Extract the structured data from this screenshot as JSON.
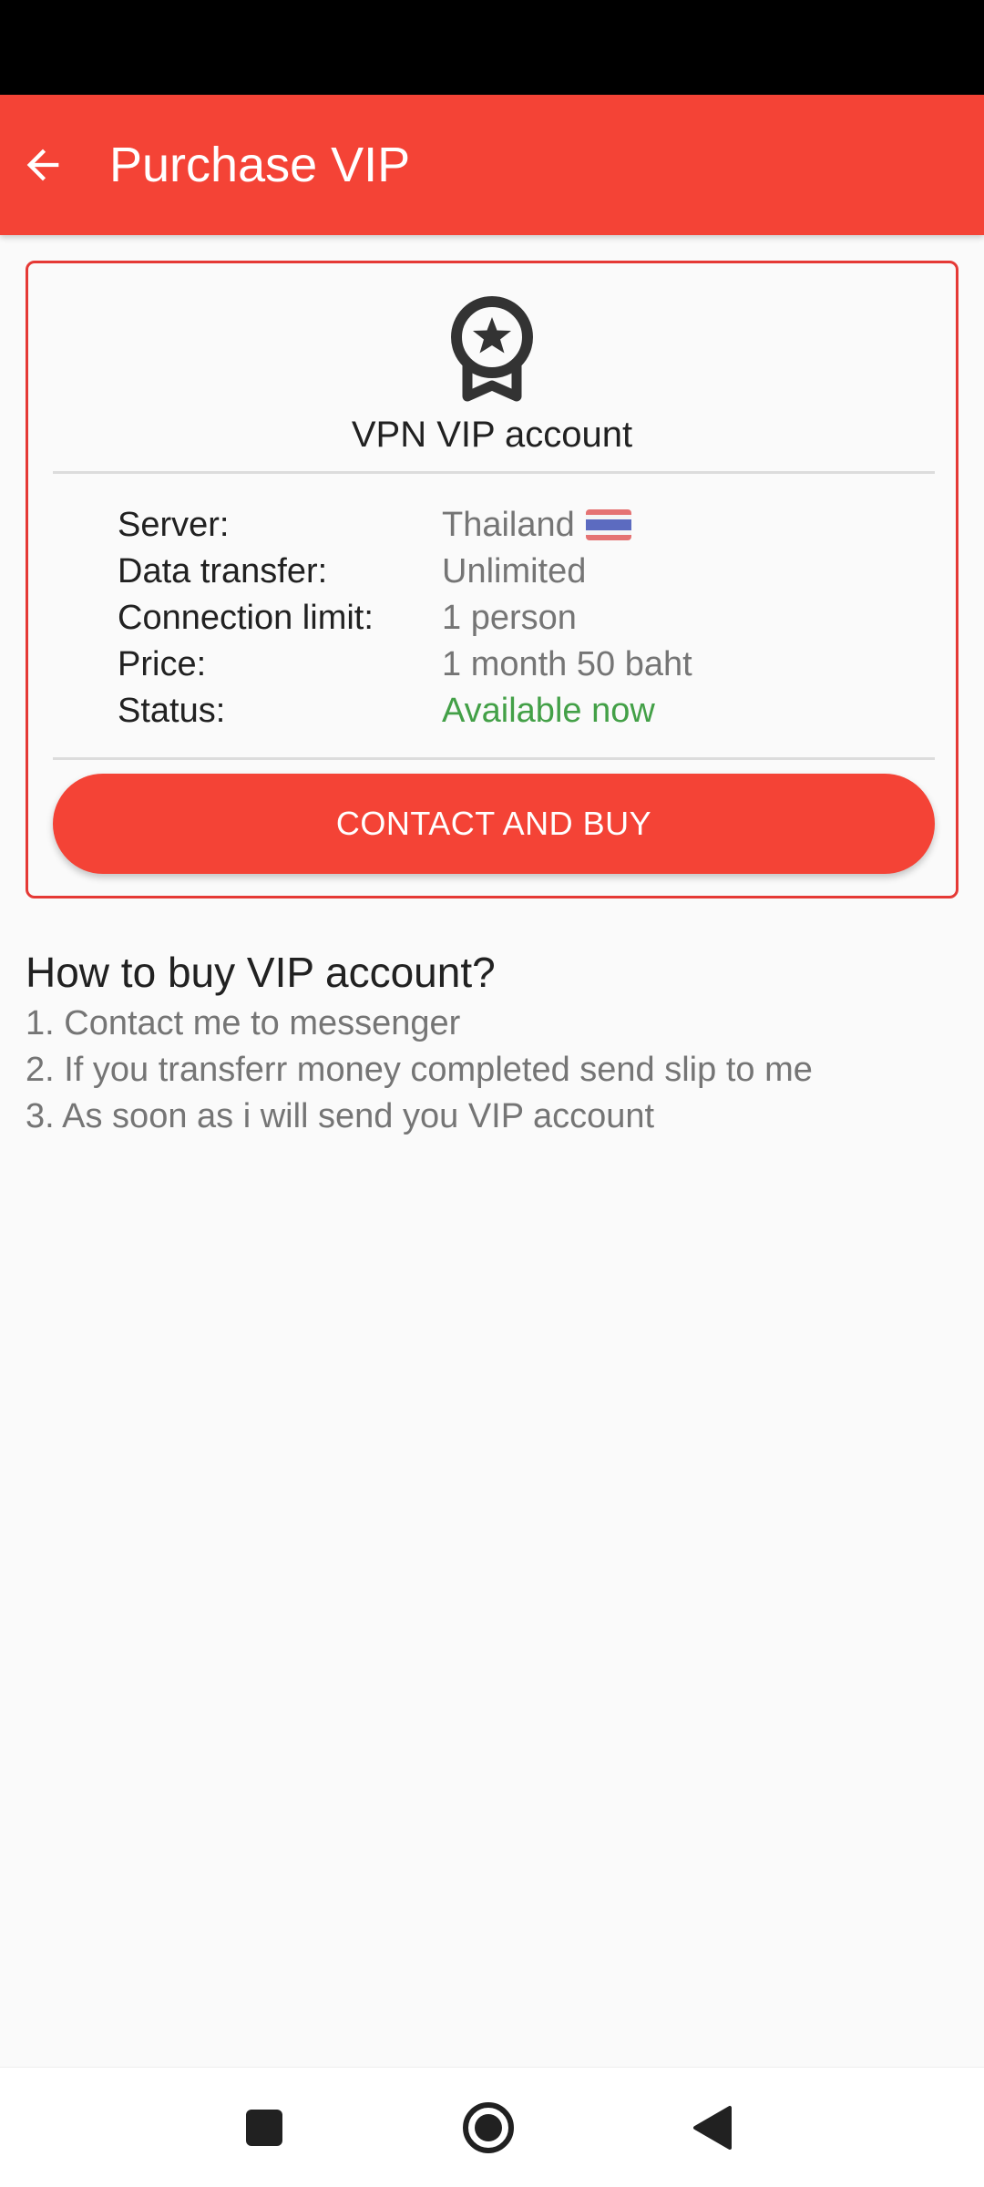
{
  "app_bar": {
    "title": "Purchase VIP",
    "back_icon": "arrow-back-icon",
    "color": "#f44336"
  },
  "card": {
    "icon": "medal-star-icon",
    "title": "VPN VIP account",
    "rows": [
      {
        "label": "Server:",
        "value": "Thailand",
        "flag": "thailand-flag-icon"
      },
      {
        "label": "Data transfer:",
        "value": "Unlimited"
      },
      {
        "label": "Connection limit:",
        "value": "1 person"
      },
      {
        "label": "Price:",
        "value": "1 month 50 baht"
      },
      {
        "label": "Status:",
        "value": "Available now",
        "color": "#43a047"
      }
    ],
    "button_label": "CONTACT AND BUY",
    "border_color": "#e53935"
  },
  "how_to": {
    "title": "How to buy VIP account?",
    "steps": [
      "1. Contact me to messenger",
      "2. If you transferr money completed send slip to me",
      "3. As soon as i will send you VIP account"
    ]
  },
  "nav_bar": {
    "buttons": [
      "recents-square-icon",
      "home-circle-icon",
      "back-triangle-icon"
    ]
  }
}
